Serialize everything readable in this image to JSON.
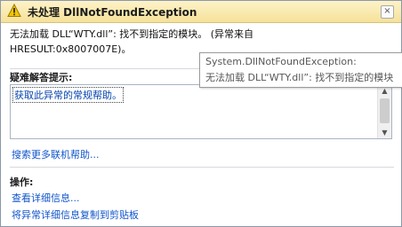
{
  "dialog": {
    "title": "未处理 DllNotFoundException",
    "close_glyph": "×",
    "message_line1": "无法加载 DLL“WTY.dll”: 找不到指定的模块。 (异常来自",
    "message_line2": "HRESULT:0x8007007E)。"
  },
  "tooltip": {
    "line1": "System.DllNotFoundException:",
    "line2": "无法加载 DLL“WTY.dll”: 找不到指定的模块"
  },
  "troubleshooting": {
    "heading": "疑难解答提示:",
    "items": [
      {
        "label": "获取此异常的常规帮助。"
      }
    ],
    "search_link": "搜索更多联机帮助..."
  },
  "actions": {
    "heading": "操作:",
    "items": [
      {
        "label": "查看详细信息..."
      },
      {
        "label": "将异常详细信息复制到剪贴板"
      }
    ]
  },
  "icons": {
    "warning": "warning-icon",
    "close": "close-icon",
    "scroll_up": "scroll-up-arrow-icon",
    "scroll_down": "scroll-down-arrow-icon"
  },
  "colors": {
    "titlebar": "#f6e19a",
    "link": "#1155cc",
    "warning": "#f2c500"
  }
}
